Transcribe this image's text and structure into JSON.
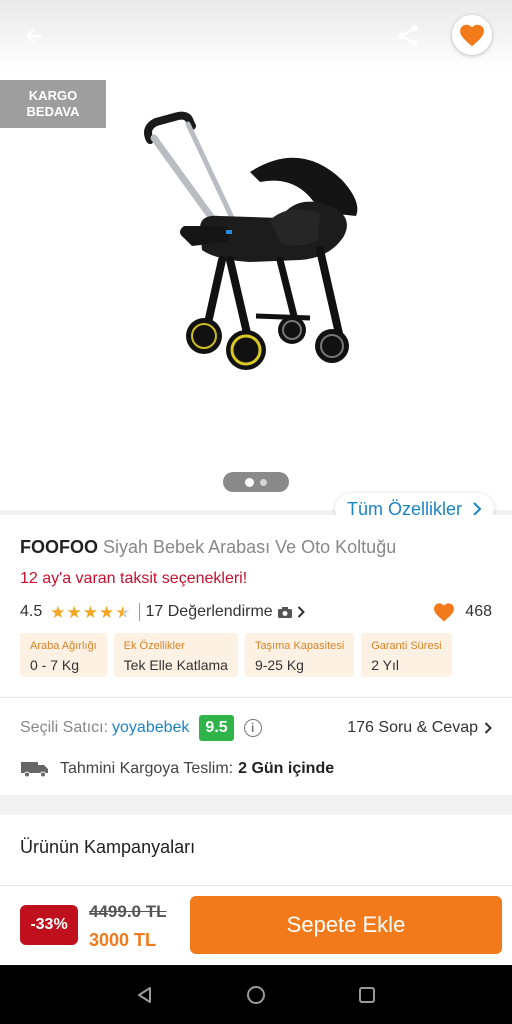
{
  "header": {
    "back_icon": "arrow-left-icon",
    "share_icon": "share-icon",
    "favorite_icon": "heart-icon",
    "favorite_color": "#f27a1a"
  },
  "gallery": {
    "badge_line1": "KARGO",
    "badge_line2": "BEDAVA",
    "image_icon": "stroller-car-seat-image",
    "pager_count": 2,
    "pager_active": 1,
    "all_features_label": "Tüm Özellikler"
  },
  "product": {
    "brand": "FOOFOO",
    "name": "Siyah Bebek Arabası Ve Oto Koltuğu",
    "installment_text": "12 ay'a varan taksit seçenekleri!",
    "rating": "4.5",
    "rating_value": 4.5,
    "review_text": "17 Değerlendirme",
    "likes": "468"
  },
  "specs": [
    {
      "key": "Araba Ağırlığı",
      "value": "0 - 7 Kg"
    },
    {
      "key": "Ek Özellikler",
      "value": "Tek Elle Katlama"
    },
    {
      "key": "Taşıma Kapasitesi",
      "value": "9-25 Kg"
    },
    {
      "key": "Garanti Süresi",
      "value": "2 Yıl"
    }
  ],
  "seller": {
    "label": "Seçili Satıcı:",
    "name": "yoyabebek",
    "score": "9.5",
    "qa_text": "176 Soru & Cevap"
  },
  "shipping": {
    "label": "Tahmini Kargoya Teslim:",
    "days": "2 Gün içinde"
  },
  "campaign": {
    "title": "Ürünün Kampanyaları"
  },
  "buybar": {
    "discount": "-33%",
    "old_price": "4499.0 TL",
    "new_price": "3000 TL",
    "add_to_cart": "Sepete Ekle",
    "accent": "#f27a1a",
    "discount_color": "#c0101d"
  },
  "system_nav": {
    "back_icon": "triangle-back-icon",
    "home_icon": "circle-home-icon",
    "recents_icon": "square-recents-icon"
  }
}
